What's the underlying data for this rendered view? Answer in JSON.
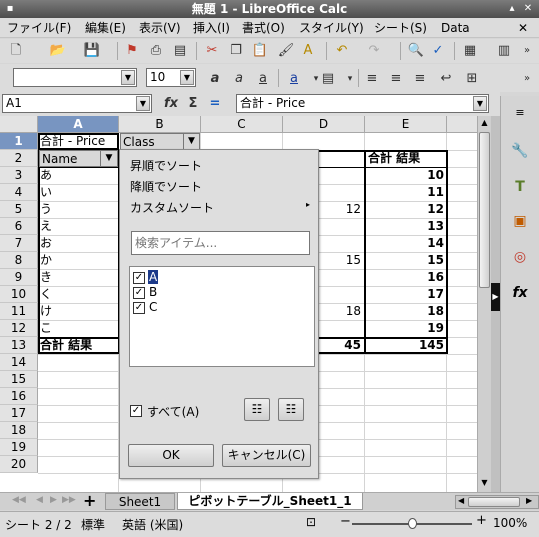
{
  "window": {
    "title": "無題 1 - LibreOffice Calc"
  },
  "menu": [
    "ファイル(F)",
    "編集(E)",
    "表示(V)",
    "挿入(I)",
    "書式(O)",
    "スタイル(Y)",
    "シート(S)",
    "Data"
  ],
  "format_bar": {
    "font_size": "10"
  },
  "formula_bar": {
    "cell_ref": "A1",
    "sigma": "Σ",
    "equals": "=",
    "content": "合計 - Price"
  },
  "columns": [
    "A",
    "B",
    "C",
    "D",
    "E"
  ],
  "rows": [
    "1",
    "2",
    "3",
    "4",
    "5",
    "6",
    "7",
    "8",
    "9",
    "10",
    "11",
    "12",
    "13",
    "14",
    "15",
    "16",
    "17",
    "18",
    "19",
    "20"
  ],
  "cells": {
    "a1": "合計 - Price",
    "b1": "Class",
    "a2": "Name",
    "a3": "あ",
    "a4": "い",
    "a5": "う",
    "a6": "え",
    "a7": "お",
    "a8": "か",
    "a9": "き",
    "a10": "く",
    "a11": "け",
    "a12": "こ",
    "a13": "合計 結果",
    "e2": "合計 結果",
    "d5": "12",
    "d8": "15",
    "d11": "18",
    "d13": "45",
    "e3": "10",
    "e4": "11",
    "e5": "12",
    "e6": "13",
    "e7": "14",
    "e8": "15",
    "e9": "16",
    "e10": "17",
    "e11": "18",
    "e12": "19",
    "e13": "145"
  },
  "popup": {
    "sort_asc": "昇順でソート",
    "sort_desc": "降順でソート",
    "custom_sort": "カスタムソート",
    "search_placeholder": "検索アイテム...",
    "items": [
      {
        "label": "A",
        "checked": true
      },
      {
        "label": "B",
        "checked": true
      },
      {
        "label": "C",
        "checked": true
      }
    ],
    "select_all": "すべて(A)",
    "ok": "OK",
    "cancel": "キャンセル(C)"
  },
  "tabs": {
    "sheet1": "Sheet1",
    "pivot": "ピボットテーブル_Sheet1_1"
  },
  "status": {
    "sheet": "シート 2 / 2",
    "style": "標準",
    "lang": "英語 (米国)",
    "zoom": "100%"
  }
}
